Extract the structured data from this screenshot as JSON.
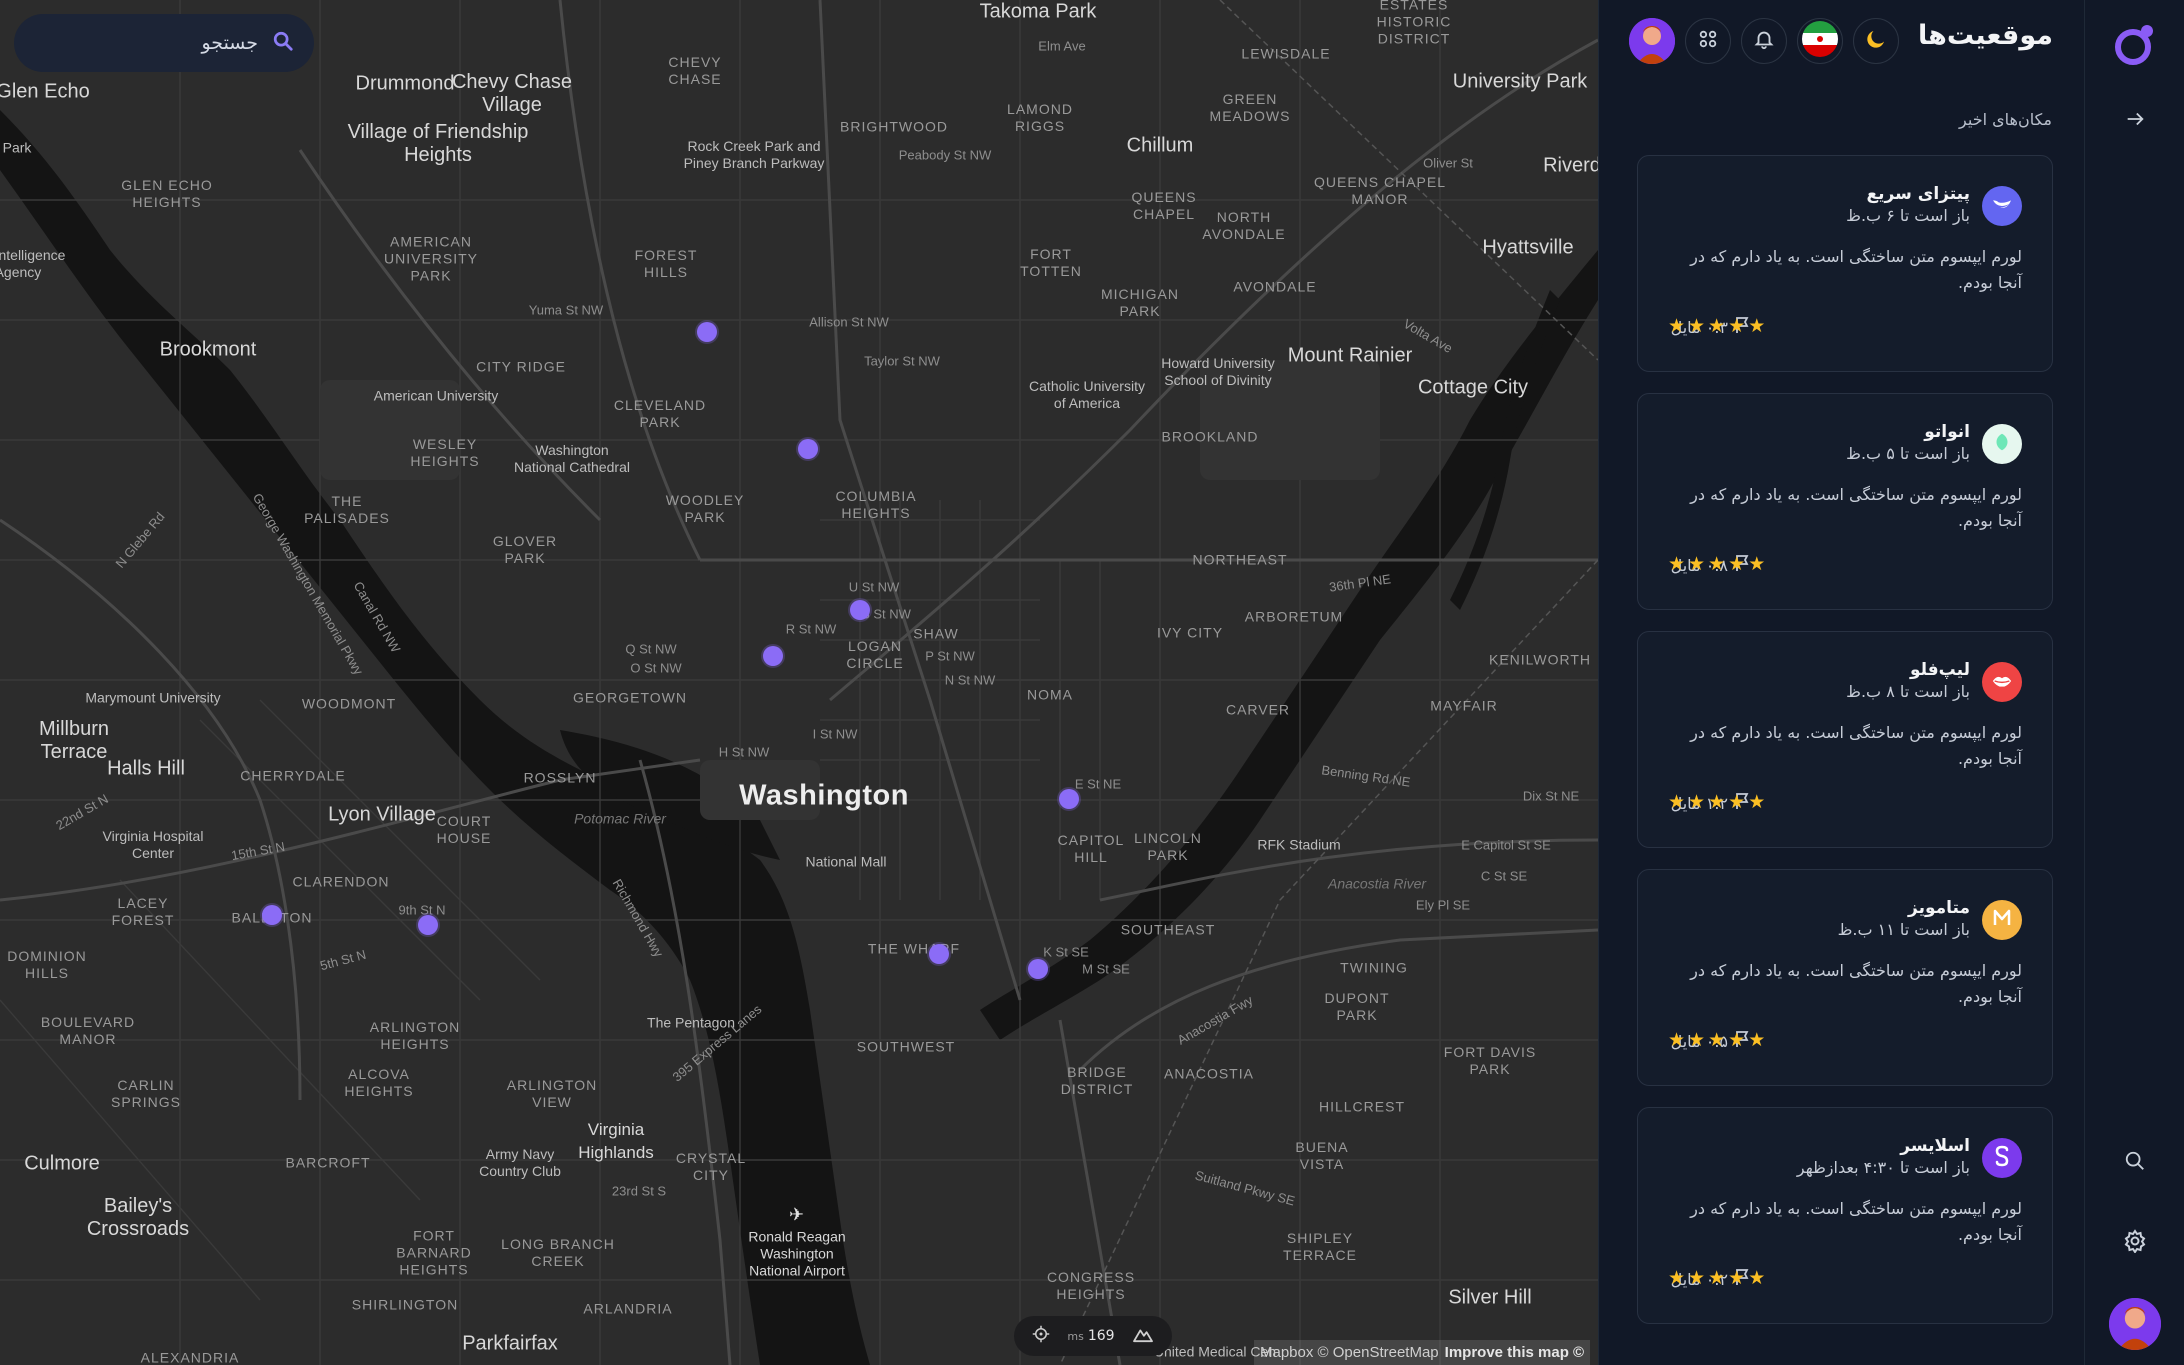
{
  "search": {
    "placeholder": "جستجو"
  },
  "header": {
    "title": "موقعیت‌ها",
    "theme_icon": "moon-icon",
    "flag_icon": "iran-flag-icon",
    "notification_icon": "bell-icon",
    "apps_icon": "grid-icon"
  },
  "recent": {
    "title": "مکان‌های اخیر"
  },
  "places": [
    {
      "name": "پیتزای سریع",
      "hours": "باز است تا ۶ ب.ظ",
      "description": "لورم ایپسوم متن ساختگی است. به یاد دارم که در آنجا بودم.",
      "distance": "۰.۳ مایل",
      "rating": 5,
      "logo_color": "#6366f1",
      "logo_icon": "bird-icon"
    },
    {
      "name": "انواتو",
      "hours": "باز است تا ۵ ب.ظ",
      "description": "لورم ایپسوم متن ساختگی است. به یاد دارم که در آنجا بودم.",
      "distance": "۰.۸ مایل",
      "rating": 5,
      "logo_color": "#d1fae5",
      "logo_icon": "leaf-icon"
    },
    {
      "name": "لیپ‌فلو",
      "hours": "باز است تا ۸ ب.ظ",
      "description": "لورم ایپسوم متن ساختگی است. به یاد دارم که در آنجا بودم.",
      "distance": "۱.۲ مایل",
      "rating": 5,
      "logo_color": "#ef4444",
      "logo_icon": "lips-icon"
    },
    {
      "name": "متامویز",
      "hours": "باز است تا ۱۱ ب.ظ",
      "description": "لورم ایپسوم متن ساختگی است. به یاد دارم که در آنجا بودم.",
      "distance": "۰.۵ مایل",
      "rating": 5,
      "logo_color": "#f59e0b",
      "logo_icon": "m-letter-icon"
    },
    {
      "name": "اسلایسر",
      "hours": "باز است تا ۴:۳۰ بعدازظهر",
      "description": "لورم ایپسوم متن ساختگی است. به یاد دارم که در آنجا بودم.",
      "distance": "۰.۲ مایل",
      "rating": 5,
      "logo_color": "#7c3aed",
      "logo_icon": "s-letter-icon"
    }
  ],
  "map": {
    "perf_value": "169",
    "perf_unit": "ms",
    "attribution_left": "Mapbox © OpenStreetMap",
    "attribution_right": "Improve this map ©",
    "labels": {
      "takoma": "Takoma Park",
      "chevy_chase": "Chevy Chase\nVillage",
      "drummond": "Drummond",
      "friendship": "Village of Friendship\nHeights",
      "glen_echo": "Glen Echo",
      "university_park": "University Park",
      "chillum": "Chillum",
      "hyattsville": "Hyattsville",
      "riverd": "Riverd",
      "brookmont": "Brookmont",
      "mount_rainier": "Mount Rainier",
      "cottage_city": "Cottage City",
      "washington": "Washington",
      "lyon_village": "Lyon Village",
      "halls_hill": "Halls Hill",
      "millburn": "Millburn\nTerrace",
      "baileys": "Bailey's\nCrossroads",
      "culmore": "Culmore",
      "silver_hill": "Silver Hill",
      "parkfairfax": "Parkfairfax",
      "alexandria": "ALEXANDRIA",
      "brightwood": "BRIGHTWOOD",
      "lamond_riggs": "LAMOND\nRIGGS",
      "queens_chapel": "QUEENS\nCHAPEL",
      "green_meadows": "GREEN\nMEADOWS",
      "lewisdale": "LEWISDALE",
      "estates": "ESTATES\nHISTORIC\nDISTRICT",
      "queens_manor": "QUEENS CHAPEL\nMANOR",
      "north_avondale": "NORTH\nAVONDALE",
      "avondale": "AVONDALE",
      "fort_totten": "FORT\nTOTTEN",
      "michigan_park": "MICHIGAN\nPARK",
      "brookland": "BROOKLAND",
      "northeast": "NORTHEAST",
      "arboretum": "ARBORETUM",
      "ivy_city": "IVY CITY",
      "carver": "CARVER",
      "mayfair": "MAYFAIR",
      "kenilworth": "KENILWORTH",
      "noma": "NOMA",
      "shaw": "SHAW",
      "logan": "LOGAN\nCIRCLE",
      "columbia": "COLUMBIA\nHEIGHTS",
      "cleveland": "CLEVELAND\nPARK",
      "woodley": "WOODLEY\nPARK",
      "glover": "GLOVER\nPARK",
      "georgetown": "GEORGETOWN",
      "forest_hills": "FOREST\nHILLS",
      "chevy_chase_dc": "CHEVY\nCHASE",
      "city_ridge": "CITY RIDGE",
      "wesley": "WESLEY\nHEIGHTS",
      "palisades": "THE\nPALISADES",
      "american_univ_park": "AMERICAN\nUNIVERSITY\nPARK",
      "glen_echo_heights": "GLEN ECHO\nHEIGHTS",
      "woodmont": "WOODMONT",
      "cherrydale": "CHERRYDALE",
      "rosslyn": "ROSSLYN",
      "court_house": "COURT\nHOUSE",
      "clarendon": "CLARENDON",
      "ballston": "BALLSTON",
      "lacey": "LACEY\nFOREST",
      "dominion": "DOMINION\nHILLS",
      "boulevard": "BOULEVARD\nMANOR",
      "arlington_heights": "ARLINGTON\nHEIGHTS",
      "alcova": "ALCOVA\nHEIGHTS",
      "arlington_view": "ARLINGTON\nVIEW",
      "carlin": "CARLIN\nSPRINGS",
      "barcroft": "BARCROFT",
      "fort_barnard": "FORT\nBARNARD\nHEIGHTS",
      "long_branch": "LONG BRANCH\nCREEK",
      "shirlington": "SHIRLINGTON",
      "arlandria": "ARLANDRIA",
      "crystal": "CRYSTAL\nCITY",
      "southwest": "SOUTHWEST",
      "the_wharf": "THE WHARF",
      "capitol_hill": "CAPITOL\nHILL",
      "lincoln_park": "LINCOLN\nPARK",
      "southeast": "SOUTHEAST",
      "twining": "TWINING",
      "dupont_park": "DUPONT\nPARK",
      "fort_davis": "FORT DAVIS\nPARK",
      "anacostia": "ANACOSTIA",
      "bridge_district": "BRIDGE\nDISTRICT",
      "hillcrest": "HILLCREST",
      "buena_vista": "BUENA\nVISTA",
      "congress_heights": "CONGRESS\nHEIGHTS",
      "shipley": "SHIPLEY\nTERRACE",
      "national_mall": "National Mall",
      "pentagon": "The Pentagon",
      "rock_creek": "Rock Creek Park and\nPiney Branch Parkway",
      "american_university": "American University",
      "cathedral": "Washington\nNational Cathedral",
      "catholic": "Catholic University\nof America",
      "howard": "Howard University\nSchool of Divinity",
      "marymount": "Marymount University",
      "virginia_hospital": "Virginia Hospital\nCenter",
      "army_navy": "Army Navy\nCountry Club",
      "virginia_highlands": "Virginia\nHighlands",
      "reagan": "Ronald Reagan\nWashington\nNational Airport",
      "rfk": "RFK Stadium",
      "intelligence": "Intelligence\nAgency",
      "park": "Park",
      "potomac": "Potomac River",
      "anacostia_river": "Anacostia River",
      "medical": "United Medical Cen",
      "yuma": "Yuma St NW",
      "allison": "Allison St NW",
      "taylor": "Taylor St NW",
      "peabody": "Peabody St NW",
      "u_st": "U St NW",
      "s_st": "S St NW",
      "r_st": "R St NW",
      "q_st": "Q St NW",
      "o_st": "O St NW",
      "p_st": "P St NW",
      "n_st": "N St NW",
      "i_st": "I St NW",
      "h_st": "H St NW",
      "e_st_ne": "E St NE",
      "k_st_se": "K St SE",
      "m_st_se": "M St SE",
      "benning": "Benning Rd NE",
      "e_capitol": "E Capitol St SE",
      "c_st_se": "C St SE",
      "ely": "Ely Pl SE",
      "nglebe": "N Glebe Rd",
      "canal": "Canal Rd NW",
      "gwmp": "George Washington Memorial Pkwy",
      "richmond": "Richmond Hwy",
      "express": "395 Express Lanes",
      "anacostia_fwy": "Anacostia Fwy",
      "suitland": "Suitland Pkwy SE",
      "st_23": "23rd St S",
      "ninth": "9th St N",
      "fifth": "5th St N",
      "fifteenth": "15th St N",
      "twentysecond": "22nd St N",
      "oliver": "Oliver St",
      "elm": "Elm Ave",
      "thirtysixth": "36th Pl NE",
      "volta": "Volta Ave",
      "dix": "Dix St NE"
    }
  }
}
